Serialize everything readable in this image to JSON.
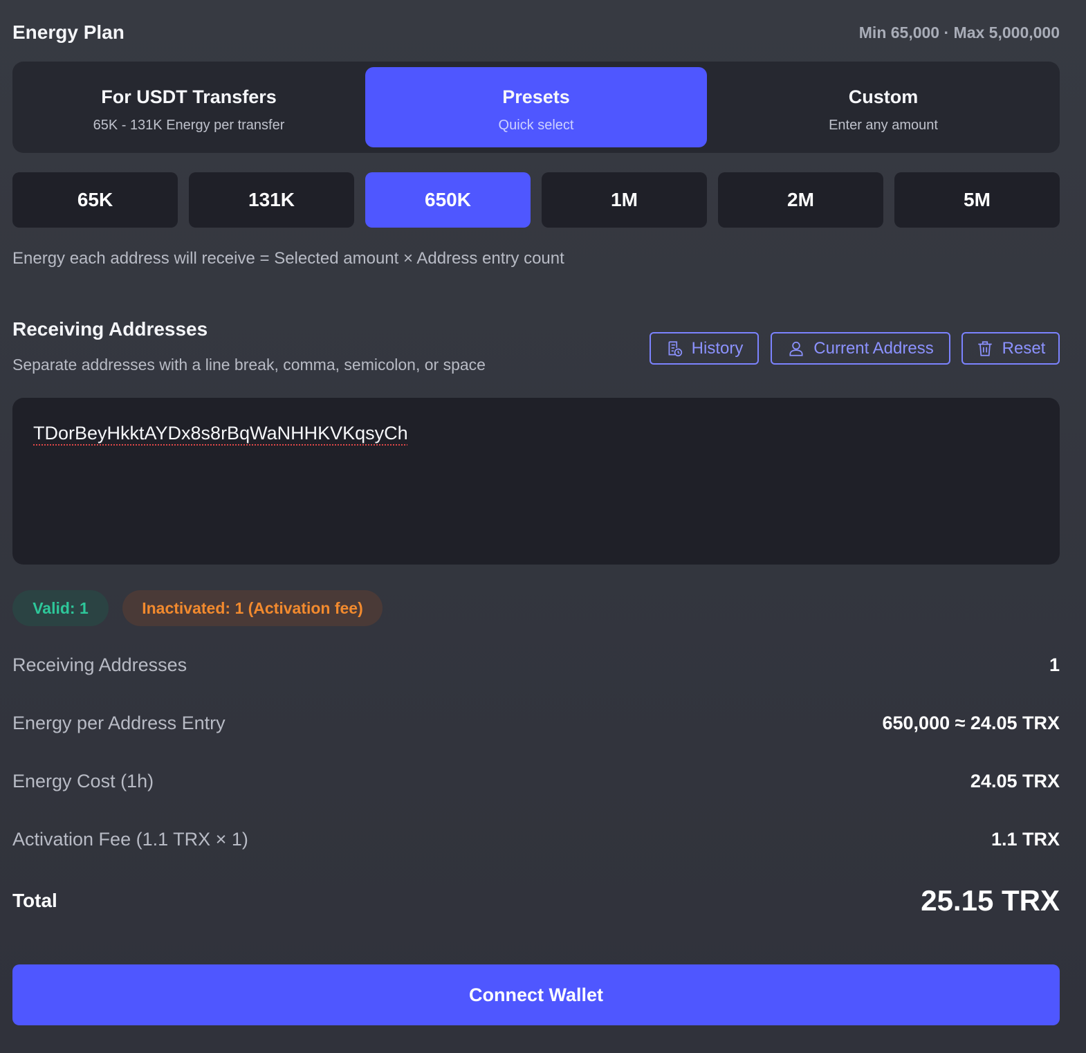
{
  "header": {
    "title": "Energy Plan",
    "limits": "Min 65,000 · Max 5,000,000"
  },
  "modes": [
    {
      "label": "For USDT Transfers",
      "sub": "65K - 131K Energy per transfer",
      "active": false
    },
    {
      "label": "Presets",
      "sub": "Quick select",
      "active": true
    },
    {
      "label": "Custom",
      "sub": "Enter any amount",
      "active": false
    }
  ],
  "presets": [
    {
      "label": "65K",
      "active": false
    },
    {
      "label": "131K",
      "active": false
    },
    {
      "label": "650K",
      "active": true
    },
    {
      "label": "1M",
      "active": false
    },
    {
      "label": "2M",
      "active": false
    },
    {
      "label": "5M",
      "active": false
    }
  ],
  "formula": "Energy each address will receive = Selected amount × Address entry count",
  "addresses": {
    "title": "Receiving Addresses",
    "hint": "Separate addresses with a line break, comma, semicolon, or space",
    "history_label": "History",
    "current_label": "Current Address",
    "reset_label": "Reset",
    "value": "TDorBeyHkktAYDx8s8rBqWaNHHKVKqsyCh",
    "valid_badge": "Valid: 1",
    "inactive_badge": "Inactivated: 1 (Activation fee)"
  },
  "summary": {
    "rows": [
      {
        "label": "Receiving Addresses",
        "value": "1"
      },
      {
        "label": "Energy per Address Entry",
        "value": "650,000 ≈ 24.05 TRX"
      },
      {
        "label": "Energy Cost (1h)",
        "value": "24.05 TRX"
      },
      {
        "label": "Activation Fee (1.1 TRX × 1)",
        "value": "1.1 TRX"
      }
    ],
    "total_label": "Total",
    "total_value": "25.15 TRX"
  },
  "actions": {
    "connect_label": "Connect Wallet"
  },
  "colors": {
    "accent": "#4f57ff",
    "valid": "#2ec79a",
    "warning": "#f28a2e"
  },
  "icons": {
    "history": "history-icon",
    "current_address": "user-icon",
    "reset": "trash-icon"
  }
}
